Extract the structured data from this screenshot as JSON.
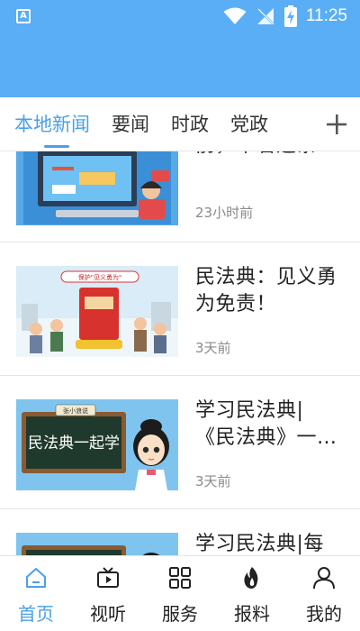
{
  "status_bar": {
    "time": "11:25",
    "app_icon_letter": "A"
  },
  "tabs": [
    {
      "label": "本地新闻",
      "active": true
    },
    {
      "label": "要闻",
      "active": false
    },
    {
      "label": "时政",
      "active": false
    },
    {
      "label": "党政",
      "active": false
    }
  ],
  "tab_add_icon": "plus-icon",
  "news": [
    {
      "title": "前，不看这条…",
      "time": "23小时前",
      "thumb_icon": "computer-office-illustration"
    },
    {
      "title": "民法典：见义勇为免责！",
      "time": "3天前",
      "thumb_icon": "civil-code-book-crowd-illustration",
      "thumb_text": "保护\"见义勇为\""
    },
    {
      "title": "学习民法典|《民法典》一…",
      "time": "3天前",
      "thumb_icon": "blackboard-girl-illustration",
      "thumb_text": "民法典一起学",
      "thumb_sign": "张小浪说"
    },
    {
      "title": "学习民法典|每",
      "time": "",
      "thumb_icon": "blackboard-girl-illustration"
    }
  ],
  "bottom_nav": [
    {
      "label": "首页",
      "icon": "home-icon",
      "active": true
    },
    {
      "label": "视听",
      "icon": "tv-play-icon",
      "active": false
    },
    {
      "label": "服务",
      "icon": "grid-icon",
      "active": false
    },
    {
      "label": "报料",
      "icon": "flame-icon",
      "active": false
    },
    {
      "label": "我的",
      "icon": "person-icon",
      "active": false
    }
  ],
  "colors": {
    "header": "#5aaef5",
    "accent": "#4a9fe8",
    "text": "#222222",
    "muted": "#8a8a8a"
  }
}
